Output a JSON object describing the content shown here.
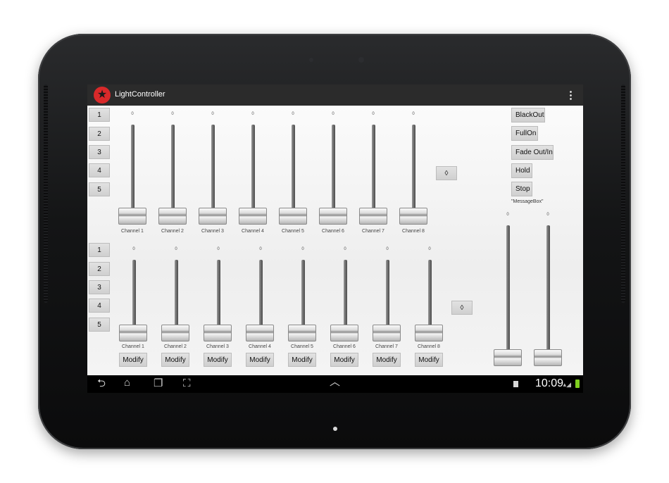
{
  "app": {
    "title": "LightController"
  },
  "top_bank": {
    "selectors": [
      "1",
      "2",
      "3",
      "4",
      "5"
    ],
    "channels": [
      {
        "label": "Channel 1",
        "value": "0"
      },
      {
        "label": "Channel 2",
        "value": "0"
      },
      {
        "label": "Channel 3",
        "value": "0"
      },
      {
        "label": "Channel 4",
        "value": "0"
      },
      {
        "label": "Channel 5",
        "value": "0"
      },
      {
        "label": "Channel 6",
        "value": "0"
      },
      {
        "label": "Channel 7",
        "value": "0"
      },
      {
        "label": "Channel 8",
        "value": "0"
      }
    ],
    "toggle_label": "◊"
  },
  "bottom_bank": {
    "selectors": [
      "1",
      "2",
      "3",
      "4",
      "5"
    ],
    "channels": [
      {
        "label": "Channel 1",
        "value": "0"
      },
      {
        "label": "Channel 2",
        "value": "0"
      },
      {
        "label": "Channel 3",
        "value": "0"
      },
      {
        "label": "Channel 4",
        "value": "0"
      },
      {
        "label": "Channel 5",
        "value": "0"
      },
      {
        "label": "Channel 6",
        "value": "0"
      },
      {
        "label": "Channel 7",
        "value": "0"
      },
      {
        "label": "Channel 8",
        "value": "0"
      }
    ],
    "modify_label": "Modify",
    "toggle_label": "◊"
  },
  "controls": {
    "blackout": "BlackOut",
    "fullon": "FullOn",
    "fade": "Fade Out/In",
    "hold": "Hold",
    "stop": "Stop",
    "message": "\"MessageBox\""
  },
  "master_faders": [
    {
      "value": "0"
    },
    {
      "value": "0"
    }
  ],
  "status_bar": {
    "time": "10:09"
  },
  "colors": {
    "accent": "#d9292a",
    "battery": "#7fcf1f",
    "action_bar": "#2b2b2b"
  }
}
